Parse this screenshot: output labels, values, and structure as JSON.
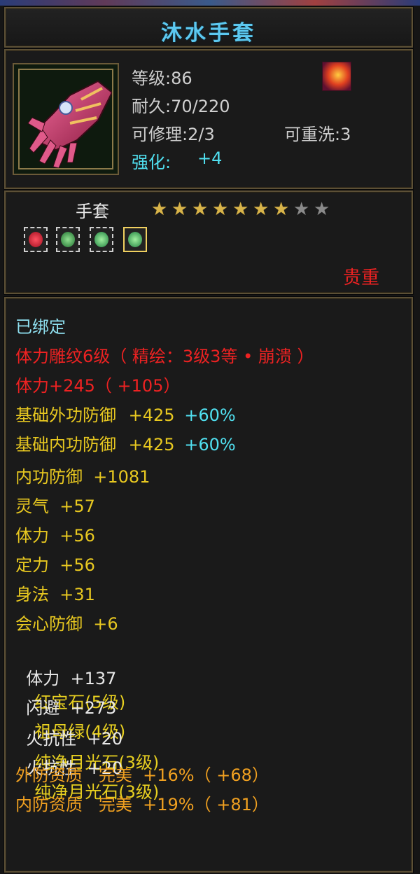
{
  "item": {
    "name": "沐水手套",
    "level": "等级:86",
    "durability": "耐久:70/220",
    "repair": "可修理:2/3",
    "rewash": "可重洗:3",
    "enhance_label": "强化:",
    "enhance_value": "+4",
    "type": "手套",
    "stars_total": 9,
    "stars_filled": 7,
    "rarity": "贵重",
    "gem_slots": [
      {
        "icon": "red-gem-icon",
        "color": "#e02030"
      },
      {
        "icon": "green-gem-icon",
        "color": "#30a040"
      },
      {
        "icon": "green-gem-icon",
        "color": "#40b050"
      },
      {
        "icon": "green-gem-icon",
        "color": "#40b050"
      }
    ]
  },
  "attributes": {
    "bound": "已绑定",
    "engrave": "体力雕纹6级（ 精绘：3级3等 • 崩溃 ）",
    "stamina_bonus": "体力+245（ +105）",
    "base_ext_def_label": "基础外功防御",
    "base_ext_def_value": "+425",
    "base_ext_def_pct": "+60%",
    "base_int_def_label": "基础内功防御",
    "base_int_def_value": "+425",
    "base_int_def_pct": "+60%",
    "int_def": "内功防御  +1081",
    "spirit": "灵气  +57",
    "stamina": "体力  +56",
    "focus": "定力  +56",
    "agility": "身法  +31",
    "crit_def": "会心防御  +6",
    "gem1_stat": "体力  +137",
    "gem1_name": "红宝石(5级)",
    "gem2_stat": "闪避  +273",
    "gem2_name": "祖母绿(4级)",
    "gem3_stat": "火抗性  +20",
    "gem3_name": "纯净月光石(3级)",
    "gem4_stat": "火抗性  +20",
    "gem4_name": "纯净月光石(3级)",
    "ext_quality": "外防资质   完美  +16%（ +68）",
    "int_quality": "内防资质   完美  +19%（ +81）"
  },
  "colors": {
    "title": "#5cc8f0",
    "bound": "#8fe0f0",
    "red": "#ee2222",
    "yellow": "#e8c820",
    "cyan": "#50e0f0",
    "orange": "#f0a020"
  }
}
